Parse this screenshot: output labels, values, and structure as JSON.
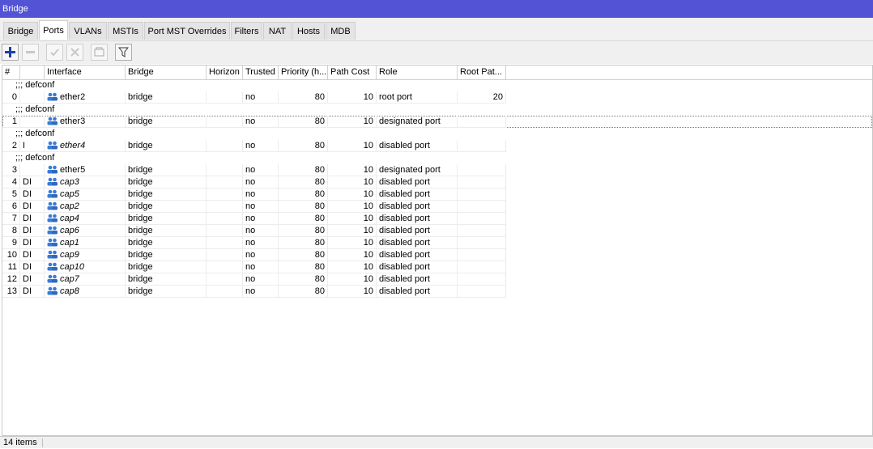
{
  "window": {
    "title": "Bridge"
  },
  "tabs": [
    {
      "label": "Bridge",
      "active": false
    },
    {
      "label": "Ports",
      "active": true
    },
    {
      "label": "VLANs",
      "active": false
    },
    {
      "label": "MSTIs",
      "active": false
    },
    {
      "label": "Port MST Overrides",
      "active": false
    },
    {
      "label": "Filters",
      "active": false
    },
    {
      "label": "NAT",
      "active": false
    },
    {
      "label": "Hosts",
      "active": false
    },
    {
      "label": "MDB",
      "active": false
    }
  ],
  "toolbar": {
    "add_icon": "plus-icon",
    "remove_icon": "minus-icon",
    "enable_icon": "check-icon",
    "disable_icon": "x-icon",
    "comment_icon": "comment-icon",
    "filter_icon": "filter-icon"
  },
  "table": {
    "columns": [
      "#",
      "Interface",
      "Bridge",
      "Horizon",
      "Trusted",
      "Priority (h...",
      "Path Cost",
      "Role",
      "Root Pat..."
    ],
    "rows": [
      {
        "comment": ";;; defconf",
        "num": "0",
        "flags": "",
        "interface": "ether2",
        "italic": false,
        "bridge": "bridge",
        "horizon": "",
        "trusted": "no",
        "priority": "80",
        "path_cost": "10",
        "role": "root port",
        "root_path": "20"
      },
      {
        "comment": ";;; defconf",
        "num": "1",
        "flags": "",
        "interface": "ether3",
        "italic": false,
        "bridge": "bridge",
        "horizon": "",
        "trusted": "no",
        "priority": "80",
        "path_cost": "10",
        "role": "designated port",
        "root_path": "",
        "selected": true
      },
      {
        "comment": ";;; defconf",
        "num": "2",
        "flags": "I",
        "interface": "ether4",
        "italic": true,
        "bridge": "bridge",
        "horizon": "",
        "trusted": "no",
        "priority": "80",
        "path_cost": "10",
        "role": "disabled port",
        "root_path": ""
      },
      {
        "comment": ";;; defconf",
        "num": "3",
        "flags": "",
        "interface": "ether5",
        "italic": false,
        "bridge": "bridge",
        "horizon": "",
        "trusted": "no",
        "priority": "80",
        "path_cost": "10",
        "role": "designated port",
        "root_path": ""
      },
      {
        "comment": "",
        "num": "4",
        "flags": "DI",
        "interface": "cap3",
        "italic": true,
        "bridge": "bridge",
        "horizon": "",
        "trusted": "no",
        "priority": "80",
        "path_cost": "10",
        "role": "disabled port",
        "root_path": ""
      },
      {
        "comment": "",
        "num": "5",
        "flags": "DI",
        "interface": "cap5",
        "italic": true,
        "bridge": "bridge",
        "horizon": "",
        "trusted": "no",
        "priority": "80",
        "path_cost": "10",
        "role": "disabled port",
        "root_path": ""
      },
      {
        "comment": "",
        "num": "6",
        "flags": "DI",
        "interface": "cap2",
        "italic": true,
        "bridge": "bridge",
        "horizon": "",
        "trusted": "no",
        "priority": "80",
        "path_cost": "10",
        "role": "disabled port",
        "root_path": ""
      },
      {
        "comment": "",
        "num": "7",
        "flags": "DI",
        "interface": "cap4",
        "italic": true,
        "bridge": "bridge",
        "horizon": "",
        "trusted": "no",
        "priority": "80",
        "path_cost": "10",
        "role": "disabled port",
        "root_path": ""
      },
      {
        "comment": "",
        "num": "8",
        "flags": "DI",
        "interface": "cap6",
        "italic": true,
        "bridge": "bridge",
        "horizon": "",
        "trusted": "no",
        "priority": "80",
        "path_cost": "10",
        "role": "disabled port",
        "root_path": ""
      },
      {
        "comment": "",
        "num": "9",
        "flags": "DI",
        "interface": "cap1",
        "italic": true,
        "bridge": "bridge",
        "horizon": "",
        "trusted": "no",
        "priority": "80",
        "path_cost": "10",
        "role": "disabled port",
        "root_path": ""
      },
      {
        "comment": "",
        "num": "10",
        "flags": "DI",
        "interface": "cap9",
        "italic": true,
        "bridge": "bridge",
        "horizon": "",
        "trusted": "no",
        "priority": "80",
        "path_cost": "10",
        "role": "disabled port",
        "root_path": ""
      },
      {
        "comment": "",
        "num": "11",
        "flags": "DI",
        "interface": "cap10",
        "italic": true,
        "bridge": "bridge",
        "horizon": "",
        "trusted": "no",
        "priority": "80",
        "path_cost": "10",
        "role": "disabled port",
        "root_path": ""
      },
      {
        "comment": "",
        "num": "12",
        "flags": "DI",
        "interface": "cap7",
        "italic": true,
        "bridge": "bridge",
        "horizon": "",
        "trusted": "no",
        "priority": "80",
        "path_cost": "10",
        "role": "disabled port",
        "root_path": ""
      },
      {
        "comment": "",
        "num": "13",
        "flags": "DI",
        "interface": "cap8",
        "italic": true,
        "bridge": "bridge",
        "horizon": "",
        "trusted": "no",
        "priority": "80",
        "path_cost": "10",
        "role": "disabled port",
        "root_path": ""
      }
    ]
  },
  "status": {
    "items_count": "14 items"
  },
  "colors": {
    "titlebar": "#5353d6",
    "add_icon": "#1a3fa6",
    "iface_icon": "#3a7bd5"
  }
}
